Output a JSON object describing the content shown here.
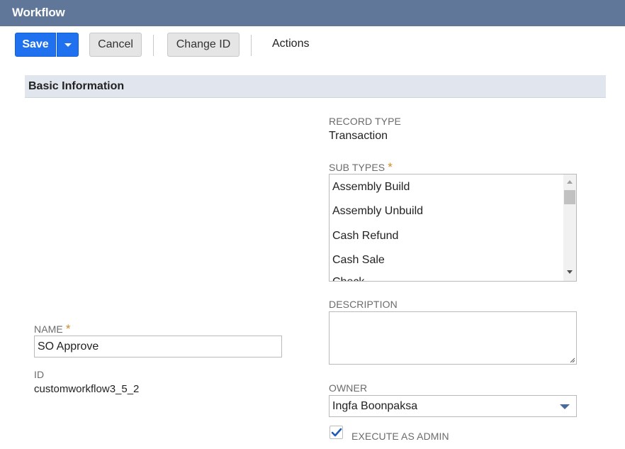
{
  "window": {
    "title": "Workflow"
  },
  "toolbar": {
    "save_label": "Save",
    "cancel_label": "Cancel",
    "change_id_label": "Change ID",
    "actions_label": "Actions"
  },
  "section": {
    "title": "Basic Information"
  },
  "fields": {
    "record_type": {
      "label": "RECORD TYPE",
      "value": "Transaction"
    },
    "sub_types": {
      "label": "SUB TYPES",
      "required_marker": "*",
      "options": [
        "Assembly Build",
        "Assembly Unbuild",
        "Cash Refund",
        "Cash Sale",
        "Check"
      ]
    },
    "description": {
      "label": "DESCRIPTION",
      "value": ""
    },
    "name": {
      "label": "NAME",
      "required_marker": "*",
      "value": "SO Approve"
    },
    "id": {
      "label": "ID",
      "value": "customworkflow3_5_2"
    },
    "owner": {
      "label": "OWNER",
      "value": "Ingfa Boonpaksa"
    },
    "execute_as_admin": {
      "label": "EXECUTE AS ADMIN",
      "checked": true
    }
  },
  "colors": {
    "titlebar": "#607799",
    "primary_button": "#1f71ef",
    "section_header": "#e1e6ee",
    "required": "#d28a1f",
    "checkmark": "#1f5bb5"
  },
  "icons": {
    "save_menu": "chevron-down-icon",
    "owner_dropdown": "caret-down-icon",
    "checkbox": "check-icon"
  }
}
